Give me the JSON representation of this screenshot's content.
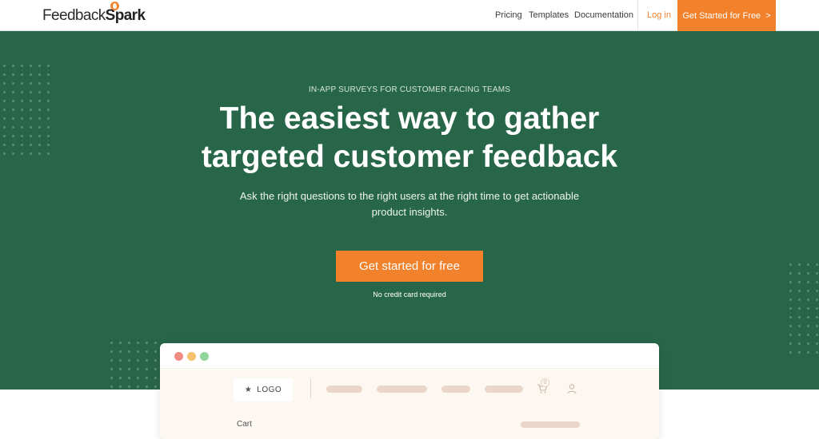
{
  "header": {
    "logo_part1": "Feedback",
    "logo_part2": "Spark",
    "nav": {
      "pricing": "Pricing",
      "templates": "Templates",
      "documentation": "Documentation",
      "login": "Log in",
      "cta": "Get Started for Free",
      "cta_arrow": ">"
    }
  },
  "hero": {
    "eyebrow": "IN-APP SURVEYS FOR CUSTOMER FACING TEAMS",
    "headline_line1": "The easiest way to gather",
    "headline_line2": "targeted customer feedback",
    "sub_line1": "Ask the right questions to the right users at the right time to get actionable",
    "sub_line2": "product insights.",
    "cta": "Get started for free",
    "note": "No credit card required"
  },
  "mock": {
    "logo_label": "LOGO",
    "cart_count": "0",
    "cart_label": "Cart"
  },
  "colors": {
    "brand_green": "#28664a",
    "accent_orange": "#f1812b",
    "traffic_red": "#f28b82",
    "traffic_yellow": "#f6c26b",
    "traffic_green": "#8fd79b"
  }
}
